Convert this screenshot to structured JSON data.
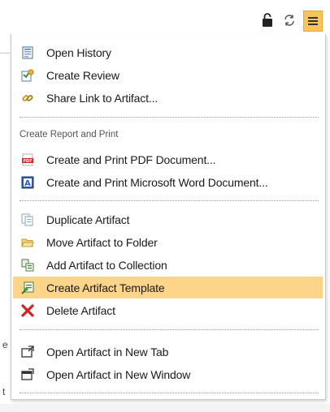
{
  "toolbar": {
    "lock_icon": "lock-icon",
    "sync_icon": "sync-icon",
    "menu_icon": "hamburger-menu-icon",
    "accent_color": "#f7c55b"
  },
  "menu": {
    "group1": [
      {
        "label": "Open History",
        "icon": "history-icon"
      },
      {
        "label": "Create Review",
        "icon": "review-icon"
      },
      {
        "label": "Share Link to Artifact...",
        "icon": "link-icon"
      }
    ],
    "report_header": "Create Report and Print",
    "group2": [
      {
        "label": "Create and Print PDF Document...",
        "icon": "pdf-icon"
      },
      {
        "label": "Create and Print Microsoft Word Document...",
        "icon": "word-icon"
      }
    ],
    "group3": [
      {
        "label": "Duplicate Artifact",
        "icon": "duplicate-icon"
      },
      {
        "label": "Move Artifact to Folder",
        "icon": "folder-icon"
      },
      {
        "label": "Add Artifact to Collection",
        "icon": "collection-icon"
      },
      {
        "label": "Create Artifact Template",
        "icon": "template-icon",
        "highlighted": true
      },
      {
        "label": "Delete Artifact",
        "icon": "delete-icon"
      }
    ],
    "group4": [
      {
        "label": "Open Artifact in New Tab",
        "icon": "new-tab-icon"
      },
      {
        "label": "Open Artifact in New Window",
        "icon": "new-window-icon"
      }
    ],
    "highlight_color": "#fdd58a"
  },
  "background": {
    "fragment_e": "e",
    "fragment_t": "t"
  }
}
